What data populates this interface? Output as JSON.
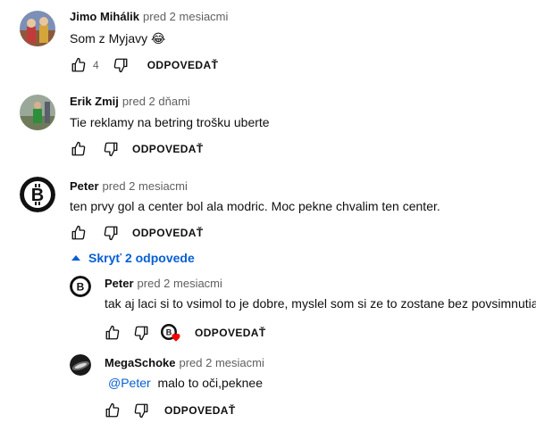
{
  "comments": [
    {
      "author": "Jimo Mihálik",
      "time": "pred 2 mesiacmi",
      "text": "Som z Myjavy 😂",
      "likes": "4",
      "reply_label": "ODPOVEDAŤ"
    },
    {
      "author": "Erik Zmij",
      "time": "pred 2 dňami",
      "text": "Tie reklamy na betring trošku uberte",
      "reply_label": "ODPOVEDAŤ"
    },
    {
      "author": "Peter",
      "time": "pred 2 mesiacmi",
      "text": "ten prvy gol a center bol ala modric. Moc pekne chvalim ten center.",
      "reply_label": "ODPOVEDAŤ"
    }
  ],
  "replies_toggle": "Skryť 2 odpovede",
  "replies": [
    {
      "author": "Peter",
      "time": "pred 2 mesiacmi",
      "text": "tak aj laci si to vsimol to je dobre, myslel som si ze to zostane bez povsimnutia",
      "reply_label": "ODPOVEDAŤ"
    },
    {
      "author": "MegaSchoke",
      "time": "pred 2 mesiacmi",
      "mention": "@Peter",
      "text": "malo to oči,peknee",
      "reply_label": "ODPOVEDAŤ"
    }
  ],
  "colors": {
    "link": "#065fd4",
    "muted": "#606060",
    "heart": "#ff0000"
  }
}
